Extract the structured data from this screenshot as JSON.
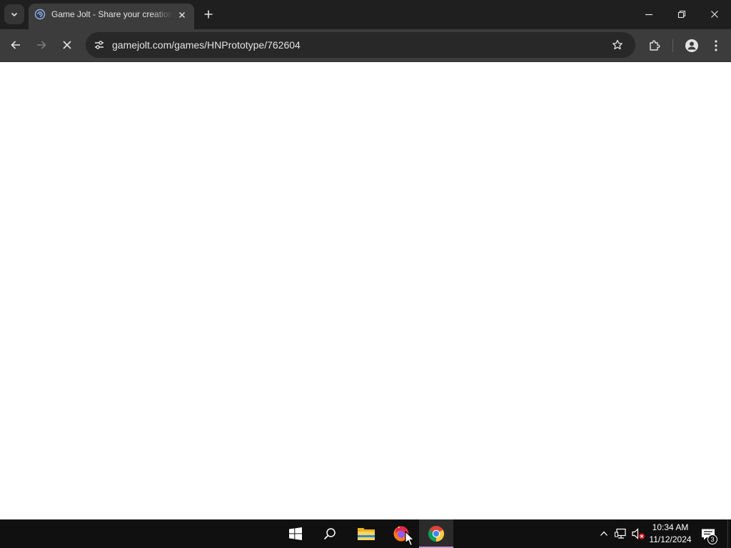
{
  "browser": {
    "tab": {
      "title": "Game Jolt - Share your creations",
      "favicon": "gamejolt-favicon-icon"
    },
    "url": "gamejolt.com/games/HNPrototype/762604",
    "loading": true,
    "colors": {
      "tabstrip": "#1f1f1f",
      "toolbar": "#3c3c3c",
      "omnibox": "#282828",
      "text": "#e3e3e3"
    }
  },
  "page": {
    "background": "#ffffff"
  },
  "taskbar": {
    "apps": [
      {
        "name": "Start",
        "icon": "windows-logo-icon"
      },
      {
        "name": "Search",
        "icon": "search-icon"
      },
      {
        "name": "File Explorer",
        "icon": "folder-icon"
      },
      {
        "name": "Firefox",
        "icon": "firefox-icon"
      },
      {
        "name": "Google Chrome",
        "icon": "chrome-icon",
        "active": true
      }
    ],
    "clock": {
      "time": "10:34 AM",
      "date": "11/12/2024"
    },
    "notifications_count": "3",
    "active_indicator_color": "#c99bd6"
  }
}
